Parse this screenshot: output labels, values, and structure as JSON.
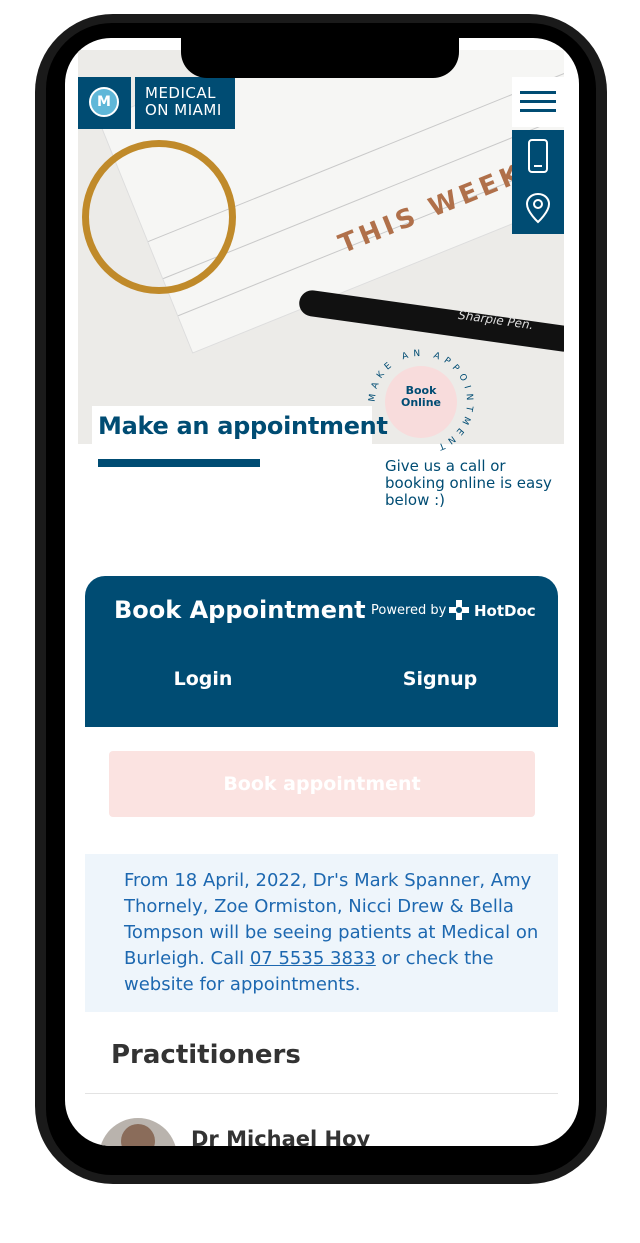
{
  "brand": {
    "logo_letter": "M",
    "line1": "MEDICAL",
    "line2": "ON MIAMI"
  },
  "icons": {
    "menu": "hamburger-menu-icon",
    "phone": "phone-icon",
    "location": "map-pin-icon"
  },
  "hero": {
    "image_text": "THIS WEEK",
    "pen_label": "Sharpie Pen.",
    "title": "Make an appointment",
    "badge_label_line1": "Book",
    "badge_label_line2": "Online",
    "badge_ring_text": "MAKE AN APPOINTMENT",
    "subtitle": "Give us a call or booking online is easy below :)"
  },
  "booking": {
    "title": "Book Appointment",
    "powered_by": "Powered by",
    "provider": "HotDoc",
    "tabs": [
      "Login",
      "Signup"
    ],
    "book_button": "Book appointment"
  },
  "notice": {
    "text_before": "From 18 April, 2022, Dr's Mark Spanner, Amy Thornely, Zoe Ormiston, Nicci Drew & Bella Tompson will be seeing patients at Medical on Burleigh. Call ",
    "phone": "07 5535 3833",
    "text_after": " or check the website for appointments."
  },
  "practitioners": {
    "heading": "Practitioners",
    "items": [
      {
        "name": "Dr Michael Hoy"
      }
    ]
  },
  "colors": {
    "brand_navy": "#004c73",
    "notice_blue": "#1d68b0",
    "notice_bg": "#eef5fb",
    "button_pink": "#fbe3e1"
  }
}
